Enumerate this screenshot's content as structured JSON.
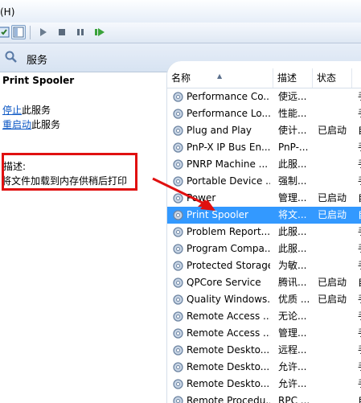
{
  "menu": {
    "help": "(H)"
  },
  "title": "服务",
  "left": {
    "service_name": "Print Spooler",
    "stop_link": "停止",
    "stop_suffix": "此服务",
    "restart_link": "重启动",
    "restart_suffix": "此服务",
    "desc_label": "描述:",
    "desc_text": "将文件加载到内存供稍后打印"
  },
  "table": {
    "headers": [
      "名称",
      "描述",
      "状态",
      ""
    ],
    "rows": [
      {
        "name": "Performance Co...",
        "desc": "使远...",
        "status": "",
        "more": "手"
      },
      {
        "name": "Performance Lo...",
        "desc": "性能...",
        "status": "",
        "more": "手"
      },
      {
        "name": "Plug and Play",
        "desc": "使计...",
        "status": "已启动",
        "more": "自"
      },
      {
        "name": "PnP-X IP Bus En...",
        "desc": "PnP-...",
        "status": "",
        "more": "手"
      },
      {
        "name": "PNRP Machine ...",
        "desc": "此服...",
        "status": "",
        "more": "手"
      },
      {
        "name": "Portable Device ...",
        "desc": "强制...",
        "status": "",
        "more": "手"
      },
      {
        "name": "Power",
        "desc": "管理...",
        "status": "已启动",
        "more": "自"
      },
      {
        "name": "Print Spooler",
        "desc": "将文...",
        "status": "已启动",
        "more": "自"
      },
      {
        "name": "Problem Report...",
        "desc": "此服...",
        "status": "",
        "more": "手"
      },
      {
        "name": "Program Compa...",
        "desc": "此服...",
        "status": "",
        "more": "手"
      },
      {
        "name": "Protected Storage",
        "desc": "为敏...",
        "status": "",
        "more": "手"
      },
      {
        "name": "QPCore Service",
        "desc": "腾讯...",
        "status": "已启动",
        "more": "自"
      },
      {
        "name": "Quality Windows...",
        "desc": "优质 ...",
        "status": "已启动",
        "more": "手"
      },
      {
        "name": "Remote Access ...",
        "desc": "无论...",
        "status": "",
        "more": "手"
      },
      {
        "name": "Remote Access ...",
        "desc": "管理...",
        "status": "",
        "more": "手"
      },
      {
        "name": "Remote Deskto...",
        "desc": "远程...",
        "status": "",
        "more": "手"
      },
      {
        "name": "Remote Deskto...",
        "desc": "允许...",
        "status": "",
        "more": "手"
      },
      {
        "name": "Remote Deskto...",
        "desc": "允许...",
        "status": "",
        "more": "手"
      },
      {
        "name": "Remote Procedu...",
        "desc": "RPC ...",
        "status": "",
        "more": "自"
      }
    ],
    "selected_index": 7
  },
  "colors": {
    "selection": "#3399ff",
    "highlight_box": "#e01010",
    "link": "#0a56c4"
  }
}
